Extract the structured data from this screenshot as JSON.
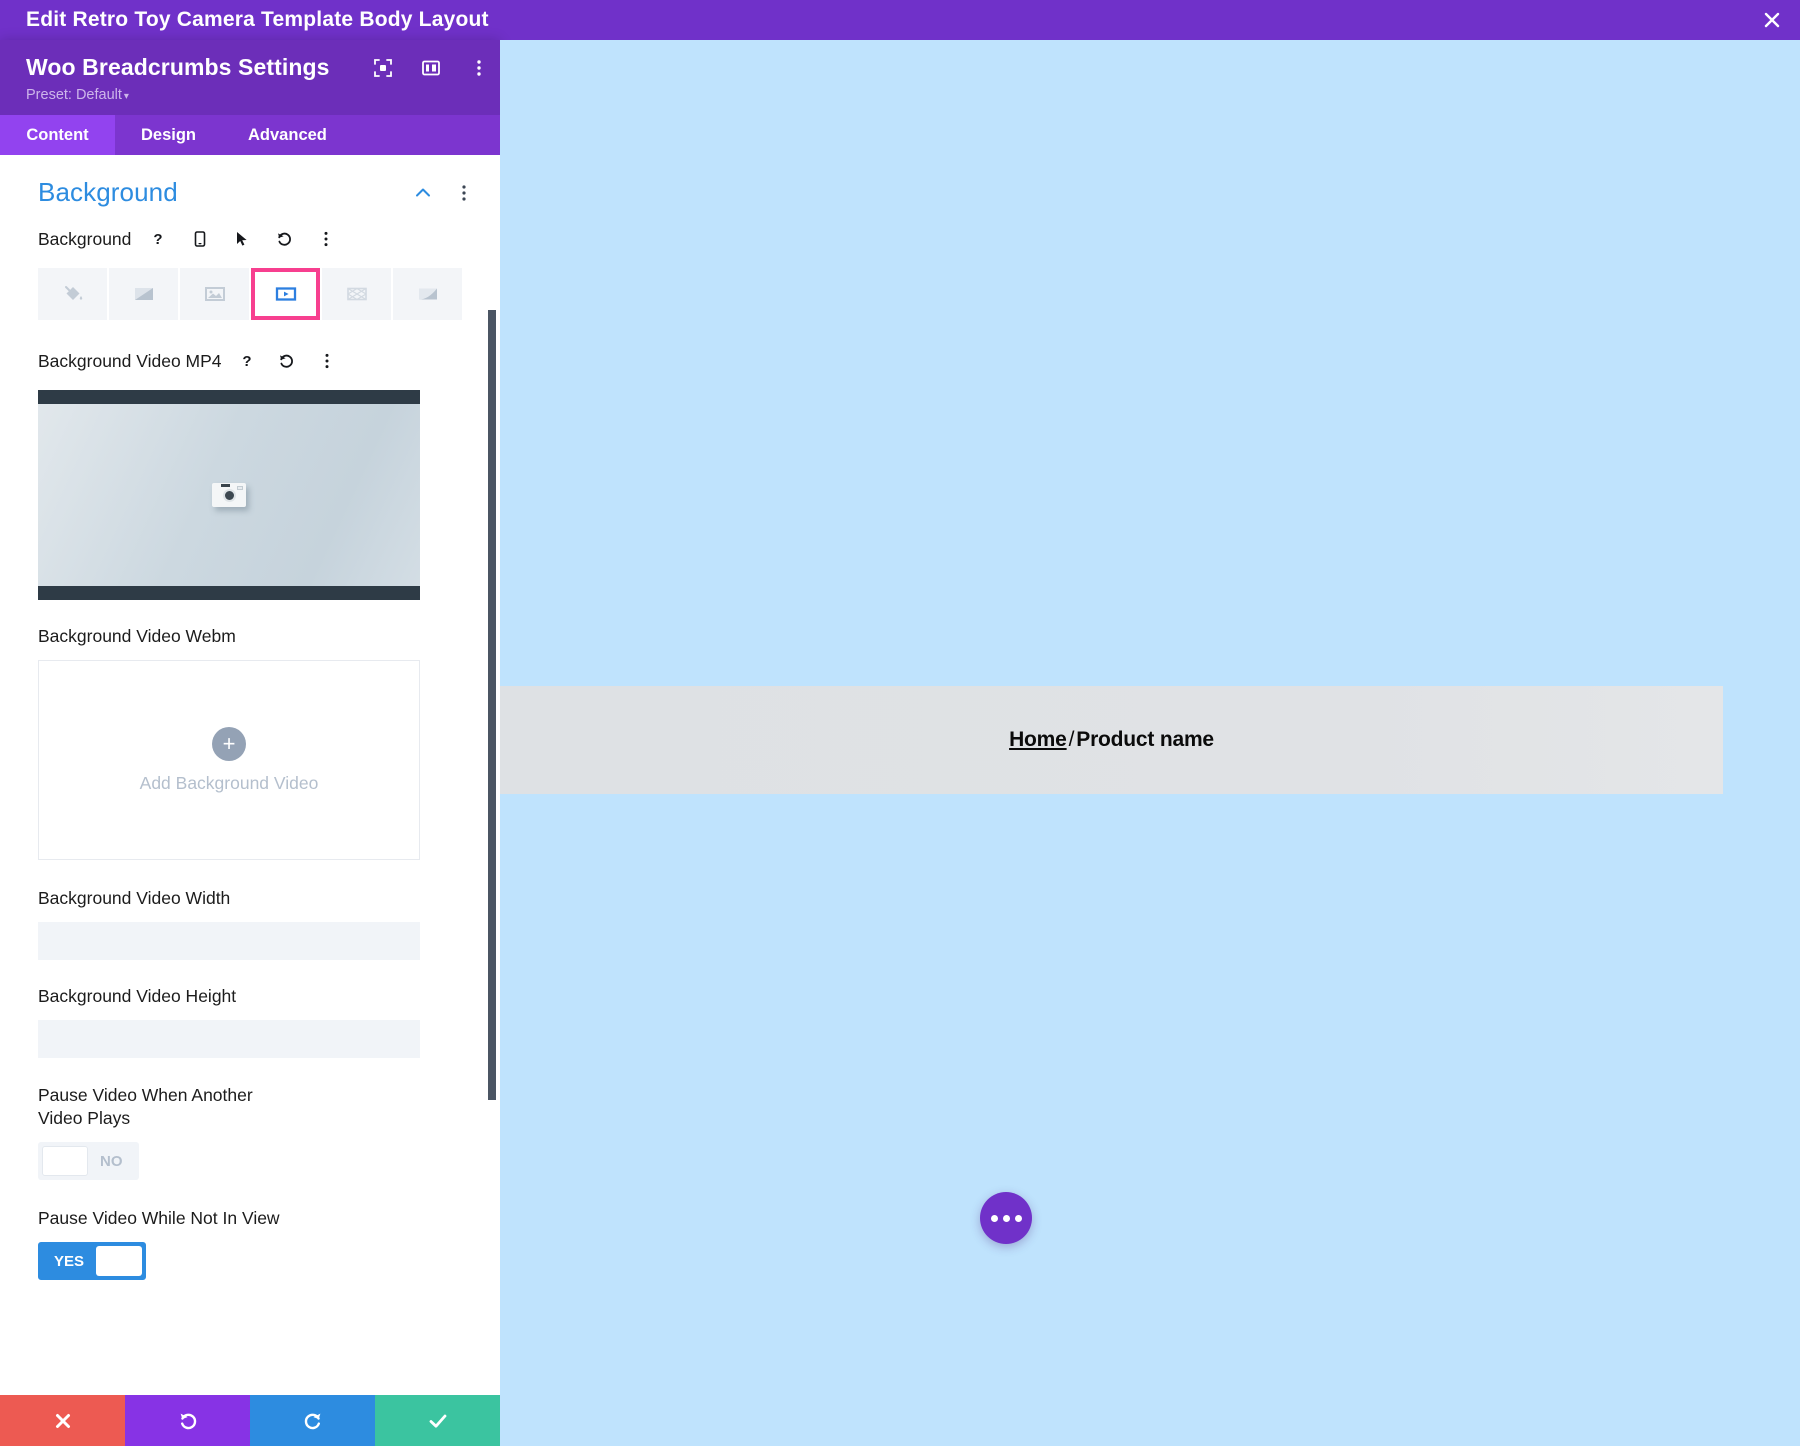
{
  "titlebar": {
    "text": "Edit Retro Toy Camera Template Body Layout",
    "close_icon": "close-icon"
  },
  "panel": {
    "title": "Woo Breadcrumbs Settings",
    "preset": "Preset: Default",
    "header_icons": [
      "focus-target-icon",
      "layout-columns-icon",
      "vertical-dots-icon"
    ],
    "tabs": [
      {
        "label": "Content",
        "active": true
      },
      {
        "label": "Design",
        "active": false
      },
      {
        "label": "Advanced",
        "active": false
      }
    ],
    "section": {
      "title": "Background",
      "collapse_icon": "chevron-up-icon",
      "menu_icon": "vertical-dots-icon"
    },
    "background_field": {
      "label": "Background",
      "icons": [
        "help-icon",
        "mobile-icon",
        "cursor-icon",
        "reset-icon",
        "vertical-dots-icon"
      ],
      "types": [
        {
          "name": "background-color",
          "selected": false
        },
        {
          "name": "background-gradient",
          "selected": false
        },
        {
          "name": "background-image",
          "selected": false
        },
        {
          "name": "background-video",
          "selected": true
        },
        {
          "name": "background-pattern",
          "selected": false
        },
        {
          "name": "background-mask",
          "selected": false
        }
      ],
      "selected_highlight_color": "#f73f8f"
    },
    "video_mp4": {
      "label": "Background Video MP4",
      "icons": [
        "help-icon",
        "reset-icon",
        "vertical-dots-icon"
      ],
      "preview_alt": "retro toy camera video thumbnail"
    },
    "video_webm": {
      "label": "Background Video Webm",
      "upload_text": "Add Background Video",
      "plus_icon": "plus-icon"
    },
    "video_width": {
      "label": "Background Video Width",
      "value": "",
      "placeholder": ""
    },
    "video_height": {
      "label": "Background Video Height",
      "value": "",
      "placeholder": ""
    },
    "pause_other_video": {
      "label": "Pause Video When Another Video Plays",
      "state": "NO",
      "on": false
    },
    "pause_not_in_view": {
      "label": "Pause Video While Not In View",
      "state": "YES",
      "on": true
    },
    "actions": [
      {
        "name": "cancel-button",
        "icon": "close-icon",
        "color": "#ed5a52"
      },
      {
        "name": "undo-button",
        "icon": "undo-icon",
        "color": "#8733e5"
      },
      {
        "name": "redo-button",
        "icon": "redo-icon",
        "color": "#2d8ce0"
      },
      {
        "name": "save-button",
        "icon": "check-icon",
        "color": "#3bc4a0"
      }
    ]
  },
  "canvas": {
    "background_color": "#bfe3fd",
    "breadcrumb": {
      "home_label": "Home",
      "separator": "/",
      "current_label": "Product name",
      "bar_color": "#dee1e4"
    },
    "fab": {
      "name": "page-settings-fab",
      "icon": "horizontal-dots-icon",
      "color": "#7031c9"
    }
  }
}
